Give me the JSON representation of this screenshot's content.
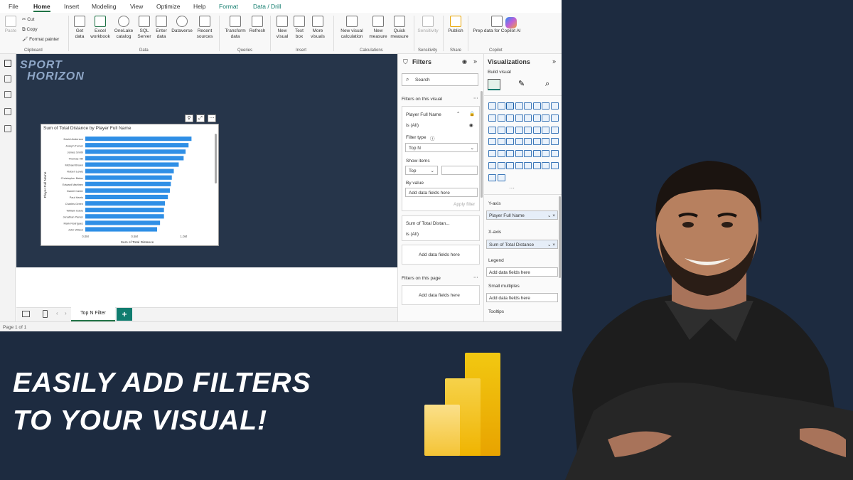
{
  "menu": {
    "items": [
      "File",
      "Home",
      "Insert",
      "Modeling",
      "View",
      "Optimize",
      "Help",
      "Format",
      "Data / Drill"
    ]
  },
  "ribbon": {
    "clipboard": {
      "paste": "Paste",
      "cut": "Cut",
      "copy": "Copy",
      "format_painter": "Format painter",
      "group": "Clipboard"
    },
    "data": {
      "get_data": "Get data",
      "excel": "Excel workbook",
      "onelake": "OneLake catalog",
      "sql": "SQL Server",
      "enter": "Enter data",
      "dataverse": "Dataverse",
      "recent": "Recent sources",
      "group": "Data"
    },
    "queries": {
      "transform": "Transform data",
      "refresh": "Refresh",
      "group": "Queries"
    },
    "insert": {
      "new_visual": "New visual",
      "text_box": "Text box",
      "more_visuals": "More visuals",
      "group": "Insert"
    },
    "calculations": {
      "new_visual_calc": "New visual calculation",
      "new_measure": "New measure",
      "quick_measure": "Quick measure",
      "group": "Calculations"
    },
    "sensitivity": {
      "label": "Sensitivity",
      "group": "Sensitivity"
    },
    "share": {
      "publish": "Publish",
      "group": "Share"
    },
    "copilot": {
      "prep": "Prep data for Copilot AI",
      "group": "Copilot"
    }
  },
  "canvas": {
    "logo_line1": "SPORT",
    "logo_line2": "HORIZON"
  },
  "chart_data": {
    "type": "bar",
    "title": "Sum of Total Distance by Player Full Name",
    "xlabel": "Sum of Total Distance",
    "ylabel": "Player Full Name",
    "categories": [
      "David Anderson",
      "Joseph Turner",
      "James Smith",
      "Thomas Hill",
      "Michael Brown",
      "Robert Lewis",
      "Christopher Baker",
      "Edward Martinez",
      "Daniel Carter",
      "Paul Harris",
      "Charles Green",
      "William Davis",
      "Jonathan Parker",
      "Mark Rodriguez",
      "John Wilson"
    ],
    "values": [
      1.08,
      1.05,
      1.02,
      1.0,
      0.95,
      0.9,
      0.88,
      0.87,
      0.86,
      0.84,
      0.81,
      0.8,
      0.8,
      0.76,
      0.73
    ],
    "xlim": [
      0,
      1.2
    ],
    "xticks": [
      "0.0M",
      "0.5M",
      "1.0M"
    ],
    "xtick_values": [
      0,
      0.5,
      1.0
    ],
    "bar_color": "#2f8fe6"
  },
  "pages": {
    "current_tab": "Top N Filter",
    "add_tab": "+",
    "status": "Page 1 of 1"
  },
  "filters_pane": {
    "title": "Filters",
    "search_placeholder": "Search",
    "on_visual": "Filters on this visual",
    "card1": {
      "field": "Player Full Name",
      "value": "is (All)",
      "filter_type_label": "Filter type",
      "filter_type": "Top N",
      "show_items_label": "Show items",
      "show_items": "Top",
      "by_value_label": "By value",
      "add_fields": "Add data fields here",
      "apply": "Apply filter"
    },
    "card2": {
      "field": "Sum of Total Distan...",
      "value": "is (All)"
    },
    "add_fields_visual": "Add data fields here",
    "on_page": "Filters on this page",
    "add_fields_page": "Add data fields here"
  },
  "viz_pane": {
    "title": "Visualizations",
    "build_visual": "Build visual",
    "y_axis_label": "Y-axis",
    "y_axis_field": "Player Full Name",
    "x_axis_label": "X-axis",
    "x_axis_field": "Sum of Total Distance",
    "legend_label": "Legend",
    "legend_well": "Add data fields here",
    "small_multiples_label": "Small multiples",
    "small_multiples_well": "Add data fields here",
    "tooltips_label": "Tooltips"
  },
  "headline": {
    "line1": "EASILY ADD FILTERS",
    "line2": "TO YOUR VISUAL!"
  },
  "colors": {
    "accent": "#107c6f",
    "background": "#1d2b40",
    "canvas": "#26354a",
    "powerbi_dark": "#e8a300",
    "powerbi_light": "#f6cc4a"
  }
}
